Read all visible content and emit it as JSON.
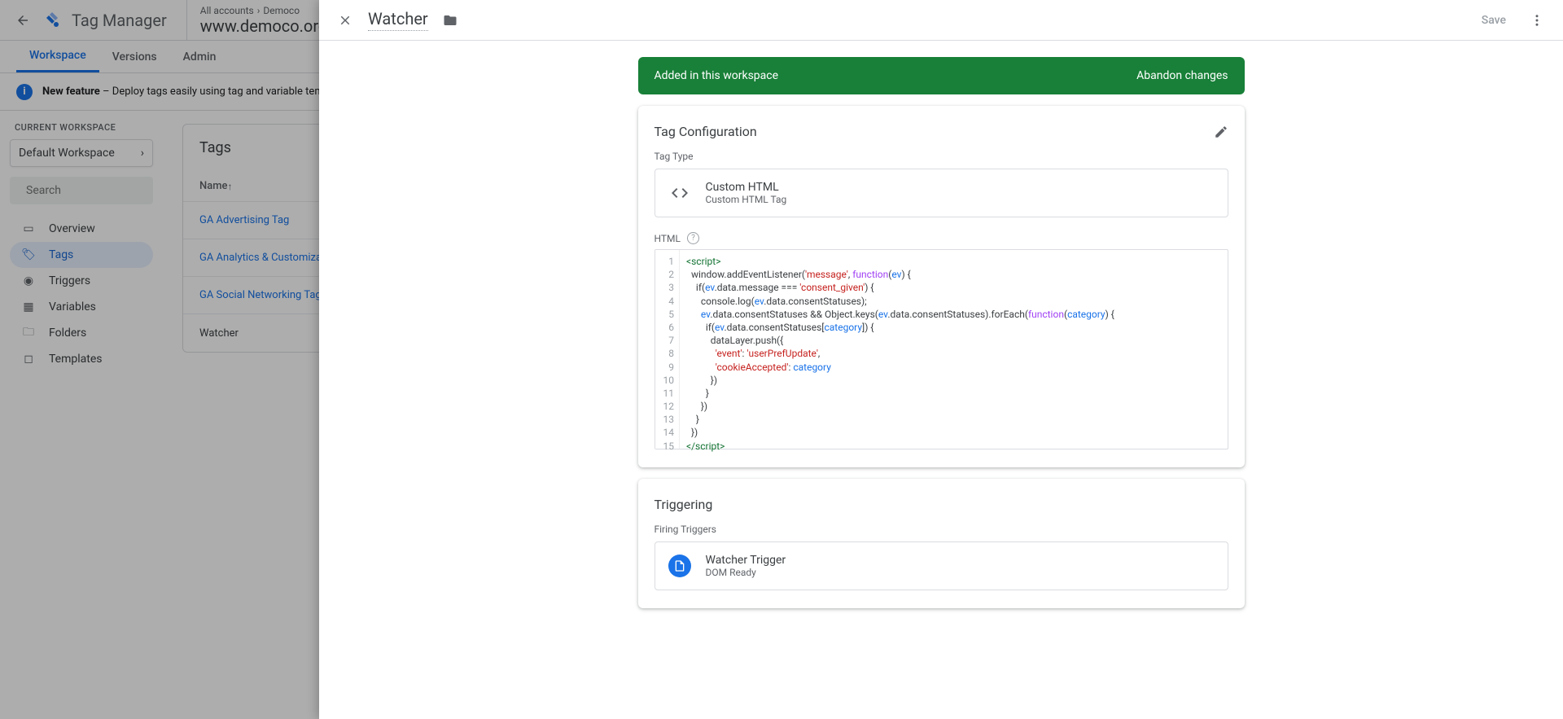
{
  "product": "Tag Manager",
  "breadcrumb": {
    "accounts": "All accounts",
    "account": "Democo",
    "container": "www.democo.org"
  },
  "tabs": {
    "workspace": "Workspace",
    "versions": "Versions",
    "admin": "Admin"
  },
  "banner": {
    "label": "New feature",
    "text": "Deploy tags easily using tag and variable templates fr"
  },
  "sidebar": {
    "current_label": "CURRENT WORKSPACE",
    "workspace": "Default Workspace",
    "search_placeholder": "Search",
    "items": [
      {
        "label": "Overview"
      },
      {
        "label": "Tags"
      },
      {
        "label": "Triggers"
      },
      {
        "label": "Variables"
      },
      {
        "label": "Folders"
      },
      {
        "label": "Templates"
      }
    ]
  },
  "tags_card": {
    "title": "Tags",
    "col_name": "Name",
    "rows": [
      {
        "name": "GA Advertising Tag"
      },
      {
        "name": "GA Analytics & Customization Tag"
      },
      {
        "name": "GA Social Networking Tag"
      },
      {
        "name": "Watcher"
      }
    ]
  },
  "panel": {
    "title": "Watcher",
    "save": "Save",
    "status_bar": {
      "text": "Added in this workspace",
      "action": "Abandon changes"
    },
    "config": {
      "title": "Tag Configuration",
      "tag_type_label": "Tag Type",
      "tag_type_name": "Custom HTML",
      "tag_type_sub": "Custom HTML Tag",
      "html_label": "HTML",
      "code_lines": [
        {
          "n": 1,
          "tokens": [
            {
              "t": "<script>",
              "c": "kw"
            }
          ]
        },
        {
          "n": 2,
          "tokens": [
            {
              "t": "  window.addEventListener("
            },
            {
              "t": "'message'",
              "c": "str"
            },
            {
              "t": ", "
            },
            {
              "t": "function",
              "c": "fn"
            },
            {
              "t": "("
            },
            {
              "t": "ev",
              "c": "var"
            },
            {
              "t": ") {"
            }
          ]
        },
        {
          "n": 3,
          "tokens": [
            {
              "t": "    if("
            },
            {
              "t": "ev",
              "c": "var"
            },
            {
              "t": ".data.message === "
            },
            {
              "t": "'consent_given'",
              "c": "str"
            },
            {
              "t": ") {"
            }
          ]
        },
        {
          "n": 4,
          "tokens": [
            {
              "t": "      console.log("
            },
            {
              "t": "ev",
              "c": "var"
            },
            {
              "t": ".data.consentStatuses);"
            }
          ]
        },
        {
          "n": 5,
          "tokens": [
            {
              "t": "      "
            },
            {
              "t": "ev",
              "c": "var"
            },
            {
              "t": ".data.consentStatuses && Object.keys("
            },
            {
              "t": "ev",
              "c": "var"
            },
            {
              "t": ".data.consentStatuses).forEach("
            },
            {
              "t": "function",
              "c": "fn"
            },
            {
              "t": "("
            },
            {
              "t": "category",
              "c": "var"
            },
            {
              "t": ") {"
            }
          ]
        },
        {
          "n": 6,
          "tokens": [
            {
              "t": "        if("
            },
            {
              "t": "ev",
              "c": "var"
            },
            {
              "t": ".data.consentStatuses["
            },
            {
              "t": "category",
              "c": "var"
            },
            {
              "t": "]) {"
            }
          ]
        },
        {
          "n": 7,
          "tokens": [
            {
              "t": "          dataLayer.push({"
            }
          ]
        },
        {
          "n": 8,
          "tokens": [
            {
              "t": "            "
            },
            {
              "t": "'event'",
              "c": "str"
            },
            {
              "t": ": "
            },
            {
              "t": "'userPrefUpdate'",
              "c": "str"
            },
            {
              "t": ","
            }
          ]
        },
        {
          "n": 9,
          "tokens": [
            {
              "t": "            "
            },
            {
              "t": "'cookieAccepted'",
              "c": "str"
            },
            {
              "t": ": "
            },
            {
              "t": "category",
              "c": "var"
            }
          ]
        },
        {
          "n": 10,
          "tokens": [
            {
              "t": "          })"
            }
          ]
        },
        {
          "n": 11,
          "tokens": [
            {
              "t": "        }"
            }
          ]
        },
        {
          "n": 12,
          "tokens": [
            {
              "t": "      })"
            }
          ]
        },
        {
          "n": 13,
          "tokens": [
            {
              "t": "    }"
            }
          ]
        },
        {
          "n": 14,
          "tokens": [
            {
              "t": "  })"
            }
          ]
        },
        {
          "n": 15,
          "tokens": [
            {
              "t": "</scr",
              "c": "kw"
            },
            {
              "t": "ipt>",
              "c": "kw"
            }
          ]
        }
      ]
    },
    "triggering": {
      "title": "Triggering",
      "firing_label": "Firing Triggers",
      "trigger_name": "Watcher Trigger",
      "trigger_type": "DOM Ready"
    }
  }
}
